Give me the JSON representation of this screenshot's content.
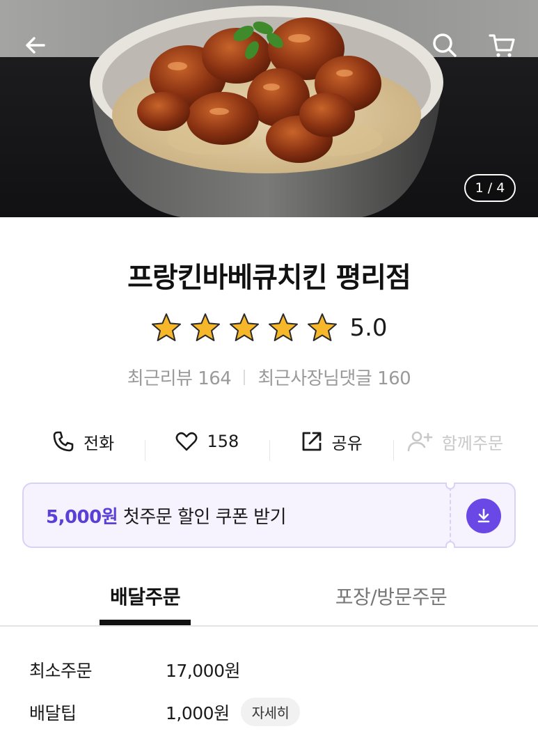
{
  "hero": {
    "image_counter": "1 / 4",
    "icons": {
      "back": "arrow-left-icon",
      "search": "search-icon",
      "cart": "cart-icon"
    }
  },
  "store": {
    "name": "프랑킨바베큐치킨 평리점",
    "rating": "5.0",
    "rating_value": 5,
    "stars": 5,
    "recent_reviews": "최근리뷰 164",
    "recent_owner_replies": "최근사장님댓글 160"
  },
  "actions": {
    "call": "전화",
    "likes": "158",
    "share": "공유",
    "group_order": "함께주문"
  },
  "coupon": {
    "amount": "5,000원",
    "text": " 첫주문 할인 쿠폰 받기",
    "accent_color": "#5b3fd6"
  },
  "tabs": {
    "delivery": "배달주문",
    "pickup": "포장/방문주문"
  },
  "info": {
    "min_order_label": "최소주문",
    "min_order_value": "17,000원",
    "delivery_tip_label": "배달팁",
    "delivery_tip_value": "1,000원",
    "detail_button": "자세히"
  }
}
